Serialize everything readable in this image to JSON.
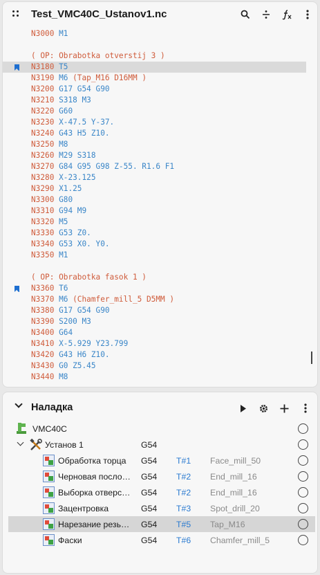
{
  "editor": {
    "title": "Test_VMC40C_Ustanov1.nc",
    "lines": [
      {
        "n": "N3000",
        "rest": [
          {
            "t": "M1",
            "k": "w"
          }
        ],
        "mark": false,
        "hl": false
      },
      {
        "n": "",
        "rest": [],
        "mark": false,
        "hl": false
      },
      {
        "n": "",
        "rest": [
          {
            "t": "( OP: Obrabotka otverstij 3 )",
            "k": "c"
          }
        ],
        "mark": false,
        "hl": false
      },
      {
        "n": "N3180",
        "rest": [
          {
            "t": "T5",
            "k": "w"
          }
        ],
        "mark": true,
        "hl": true
      },
      {
        "n": "N3190",
        "rest": [
          {
            "t": "M6",
            "k": "w"
          },
          {
            "t": "(Tap_M16 D16MM )",
            "k": "c"
          }
        ],
        "mark": false,
        "hl": false
      },
      {
        "n": "N3200",
        "rest": [
          {
            "t": "G17 G54 G90",
            "k": "w"
          }
        ],
        "mark": false,
        "hl": false
      },
      {
        "n": "N3210",
        "rest": [
          {
            "t": "S318 M3",
            "k": "w"
          }
        ],
        "mark": false,
        "hl": false
      },
      {
        "n": "N3220",
        "rest": [
          {
            "t": "G60",
            "k": "w"
          }
        ],
        "mark": false,
        "hl": false
      },
      {
        "n": "N3230",
        "rest": [
          {
            "t": "X-47.5 Y-37.",
            "k": "w"
          }
        ],
        "mark": false,
        "hl": false
      },
      {
        "n": "N3240",
        "rest": [
          {
            "t": "G43 H5 Z10.",
            "k": "w"
          }
        ],
        "mark": false,
        "hl": false
      },
      {
        "n": "N3250",
        "rest": [
          {
            "t": "M8",
            "k": "w"
          }
        ],
        "mark": false,
        "hl": false
      },
      {
        "n": "N3260",
        "rest": [
          {
            "t": "M29 S318",
            "k": "w"
          }
        ],
        "mark": false,
        "hl": false
      },
      {
        "n": "N3270",
        "rest": [
          {
            "t": "G84 G95 G98 Z-55. R1.6 F1",
            "k": "w"
          }
        ],
        "mark": false,
        "hl": false
      },
      {
        "n": "N3280",
        "rest": [
          {
            "t": "X-23.125",
            "k": "w"
          }
        ],
        "mark": false,
        "hl": false
      },
      {
        "n": "N3290",
        "rest": [
          {
            "t": "X1.25",
            "k": "w"
          }
        ],
        "mark": false,
        "hl": false
      },
      {
        "n": "N3300",
        "rest": [
          {
            "t": "G80",
            "k": "w"
          }
        ],
        "mark": false,
        "hl": false
      },
      {
        "n": "N3310",
        "rest": [
          {
            "t": "G94 M9",
            "k": "w"
          }
        ],
        "mark": false,
        "hl": false
      },
      {
        "n": "N3320",
        "rest": [
          {
            "t": "M5",
            "k": "w"
          }
        ],
        "mark": false,
        "hl": false
      },
      {
        "n": "N3330",
        "rest": [
          {
            "t": "G53 Z0.",
            "k": "w"
          }
        ],
        "mark": false,
        "hl": false
      },
      {
        "n": "N3340",
        "rest": [
          {
            "t": "G53 X0. Y0.",
            "k": "w"
          }
        ],
        "mark": false,
        "hl": false
      },
      {
        "n": "N3350",
        "rest": [
          {
            "t": "M1",
            "k": "w"
          }
        ],
        "mark": false,
        "hl": false
      },
      {
        "n": "",
        "rest": [],
        "mark": false,
        "hl": false
      },
      {
        "n": "",
        "rest": [
          {
            "t": "( OP: Obrabotka fasok 1 )",
            "k": "c"
          }
        ],
        "mark": false,
        "hl": false
      },
      {
        "n": "N3360",
        "rest": [
          {
            "t": "T6",
            "k": "w"
          }
        ],
        "mark": true,
        "hl": false
      },
      {
        "n": "N3370",
        "rest": [
          {
            "t": "M6",
            "k": "w"
          },
          {
            "t": "(Chamfer_mill_5 D5MM )",
            "k": "c"
          }
        ],
        "mark": false,
        "hl": false
      },
      {
        "n": "N3380",
        "rest": [
          {
            "t": "G17 G54 G90",
            "k": "w"
          }
        ],
        "mark": false,
        "hl": false
      },
      {
        "n": "N3390",
        "rest": [
          {
            "t": "S200 M3",
            "k": "w"
          }
        ],
        "mark": false,
        "hl": false
      },
      {
        "n": "N3400",
        "rest": [
          {
            "t": "G64",
            "k": "w"
          }
        ],
        "mark": false,
        "hl": false
      },
      {
        "n": "N3410",
        "rest": [
          {
            "t": "X-5.929 Y23.799",
            "k": "w"
          }
        ],
        "mark": false,
        "hl": false
      },
      {
        "n": "N3420",
        "rest": [
          {
            "t": "G43 H6 Z10.",
            "k": "w"
          }
        ],
        "mark": false,
        "hl": false
      },
      {
        "n": "N3430",
        "rest": [
          {
            "t": "G0 Z5.45",
            "k": "w"
          }
        ],
        "mark": false,
        "hl": false
      },
      {
        "n": "N3440",
        "rest": [
          {
            "t": "M8",
            "k": "w"
          }
        ],
        "mark": false,
        "hl": false
      }
    ]
  },
  "setup": {
    "title": "Наладка",
    "machine": "VMC40C",
    "ustanov": {
      "label": "Установ 1",
      "g": "G54"
    },
    "ops": [
      {
        "label": "Обработка торца",
        "g": "G54",
        "t": "T#1",
        "tool": "Face_mill_50",
        "selected": false
      },
      {
        "label": "Черновая посло…",
        "g": "G54",
        "t": "T#2",
        "tool": "End_mill_16",
        "selected": false
      },
      {
        "label": "Выборка отверс…",
        "g": "G54",
        "t": "T#2",
        "tool": "End_mill_16",
        "selected": false
      },
      {
        "label": "Зацентровка",
        "g": "G54",
        "t": "T#3",
        "tool": "Spot_drill_20",
        "selected": false
      },
      {
        "label": "Нарезание резь…",
        "g": "G54",
        "t": "T#5",
        "tool": "Tap_M16",
        "selected": true
      },
      {
        "label": "Фаски",
        "g": "G54",
        "t": "T#6",
        "tool": "Chamfer_mill_5",
        "selected": false
      }
    ]
  }
}
